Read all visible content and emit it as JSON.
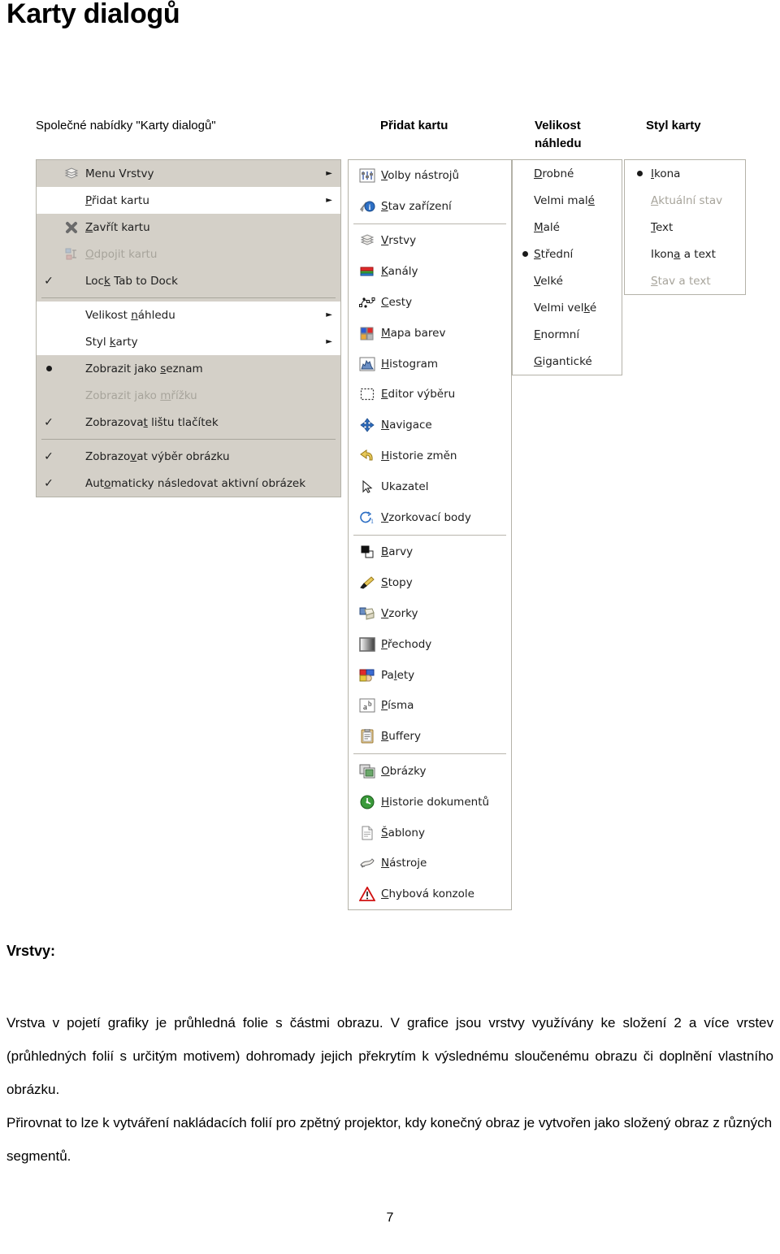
{
  "document": {
    "title": "Karty dialogů",
    "page_number": "7"
  },
  "captions": {
    "common": "Společné nabídky \"Karty dialogů\"",
    "add_tab": "Přidat kartu",
    "preview_size": "Velikost náhledu",
    "tab_style": "Styl karty"
  },
  "menu_common": {
    "items": [
      {
        "label": "Menu Vrstvy",
        "icon": "layers-icon",
        "mark": "none",
        "arrow": true,
        "state": "normal",
        "highlighted": false
      },
      {
        "label": "Přidat kartu",
        "icon": "none",
        "mark": "none",
        "arrow": true,
        "state": "normal",
        "highlighted": true,
        "accel": "P"
      },
      {
        "label": "Zavřít kartu",
        "icon": "close-x-icon",
        "mark": "none",
        "arrow": false,
        "state": "normal",
        "highlighted": false,
        "accel": "Z"
      },
      {
        "label": "Odpojit kartu",
        "icon": "detach-icon",
        "mark": "none",
        "arrow": false,
        "state": "disabled",
        "highlighted": false,
        "accel": "O"
      },
      {
        "label": "Lock Tab to Dock",
        "icon": "none",
        "mark": "check",
        "arrow": false,
        "state": "normal",
        "highlighted": false,
        "accel": "k"
      },
      {
        "separator": true
      },
      {
        "label": "Velikost náhledu",
        "icon": "none",
        "mark": "none",
        "arrow": true,
        "state": "normal",
        "highlighted": true,
        "accel": "n"
      },
      {
        "label": "Styl karty",
        "icon": "none",
        "mark": "none",
        "arrow": true,
        "state": "normal",
        "highlighted": true,
        "accel": "k"
      },
      {
        "label": "Zobrazit jako seznam",
        "icon": "none",
        "mark": "bullet",
        "arrow": false,
        "state": "normal",
        "highlighted": false,
        "accel": "s"
      },
      {
        "label": "Zobrazit jako mřížku",
        "icon": "none",
        "mark": "none",
        "arrow": false,
        "state": "disabled",
        "highlighted": false,
        "accel": "m"
      },
      {
        "label": "Zobrazovat lištu tlačítek",
        "icon": "none",
        "mark": "check",
        "arrow": false,
        "state": "normal",
        "highlighted": false,
        "accel": "t"
      },
      {
        "separator": true
      },
      {
        "label": "Zobrazovat výběr obrázku",
        "icon": "none",
        "mark": "check",
        "arrow": false,
        "state": "normal",
        "highlighted": false,
        "accel": "v"
      },
      {
        "label": "Automaticky následovat aktivní obrázek",
        "icon": "none",
        "mark": "check",
        "arrow": false,
        "state": "normal",
        "highlighted": false,
        "accel": "o"
      }
    ]
  },
  "menu_add_tab": {
    "items": [
      {
        "label": "Volby nástrojů",
        "icon": "tool-options-icon",
        "accel": "V"
      },
      {
        "label": "Stav zařízení",
        "icon": "device-status-icon",
        "accel": "S"
      },
      {
        "separator": true
      },
      {
        "label": "Vrstvy",
        "icon": "layers-icon",
        "accel": "V"
      },
      {
        "label": "Kanály",
        "icon": "channels-icon",
        "accel": "K"
      },
      {
        "label": "Cesty",
        "icon": "paths-icon",
        "accel": "C"
      },
      {
        "label": "Mapa barev",
        "icon": "colormap-icon",
        "accel": "M"
      },
      {
        "label": "Histogram",
        "icon": "histogram-icon",
        "accel": "H"
      },
      {
        "label": "Editor výběru",
        "icon": "selection-editor-icon",
        "accel": "E"
      },
      {
        "label": "Navigace",
        "icon": "navigation-icon",
        "accel": "N"
      },
      {
        "label": "Historie změn",
        "icon": "undo-history-icon",
        "accel": "H"
      },
      {
        "label": "Ukazatel",
        "icon": "pointer-icon",
        "accel": ""
      },
      {
        "label": "Vzorkovací body",
        "icon": "sample-points-icon",
        "accel": "V"
      },
      {
        "separator": true
      },
      {
        "label": "Barvy",
        "icon": "colors-icon",
        "accel": "B"
      },
      {
        "label": "Stopy",
        "icon": "brushes-icon",
        "accel": "S"
      },
      {
        "label": "Vzorky",
        "icon": "patterns-icon",
        "accel": "V"
      },
      {
        "label": "Přechody",
        "icon": "gradients-icon",
        "accel": "P"
      },
      {
        "label": "Palety",
        "icon": "palettes-icon",
        "accel": "l"
      },
      {
        "label": "Písma",
        "icon": "fonts-icon",
        "accel": "P"
      },
      {
        "label": "Buffery",
        "icon": "buffers-icon",
        "accel": "B"
      },
      {
        "separator": true
      },
      {
        "label": "Obrázky",
        "icon": "images-icon",
        "accel": "O"
      },
      {
        "label": "Historie dokumentů",
        "icon": "document-history-icon",
        "accel": "H"
      },
      {
        "label": "Šablony",
        "icon": "templates-icon",
        "accel": "Š"
      },
      {
        "label": "Nástroje",
        "icon": "tools-icon",
        "accel": "N"
      },
      {
        "label": "Chybová konzole",
        "icon": "error-console-icon",
        "accel": "C"
      }
    ]
  },
  "menu_preview_size": {
    "items": [
      {
        "label": "Drobné",
        "mark": "none",
        "accel": "D"
      },
      {
        "label": "Velmi malé",
        "mark": "none",
        "accel": "é"
      },
      {
        "label": "Malé",
        "mark": "none",
        "accel": "M"
      },
      {
        "label": "Střední",
        "mark": "bullet",
        "accel": "S"
      },
      {
        "label": "Velké",
        "mark": "none",
        "accel": "V"
      },
      {
        "label": "Velmi velké",
        "mark": "none",
        "accel": "k"
      },
      {
        "label": "Enormní",
        "mark": "none",
        "accel": "E"
      },
      {
        "label": "Gigantické",
        "mark": "none",
        "accel": "G"
      }
    ]
  },
  "menu_tab_style": {
    "items": [
      {
        "label": "Ikona",
        "mark": "bullet",
        "state": "normal",
        "accel": "I"
      },
      {
        "label": "Aktuální stav",
        "mark": "none",
        "state": "disabled",
        "accel": "A"
      },
      {
        "label": "Text",
        "mark": "none",
        "state": "normal",
        "accel": "T"
      },
      {
        "label": "Ikona a text",
        "mark": "none",
        "state": "normal",
        "accel": "a"
      },
      {
        "label": "Stav a text",
        "mark": "none",
        "state": "disabled",
        "accel": "S"
      }
    ]
  },
  "section": {
    "heading": "Vrstvy:",
    "paragraphs": [
      "Vrstva v pojetí grafiky je průhledná folie s částmi obrazu. V grafice jsou vrstvy využívány ke složení 2 a více vrstev (průhledných folií s určitým motivem) dohromady jejich překrytím k výslednému sloučenému obrazu či doplnění vlastního obrázku.",
      "Přirovnat to lze k vytváření nakládacích folií pro zpětný projektor, kdy konečný obraz je vytvořen jako složený obraz z různých segmentů."
    ]
  },
  "colors": {
    "menu_gray": "#d4d0c8",
    "menu_white": "#ffffff",
    "menu_border": "#b4b2a8",
    "disabled_text": "#a7a49b",
    "text": "#202020"
  }
}
